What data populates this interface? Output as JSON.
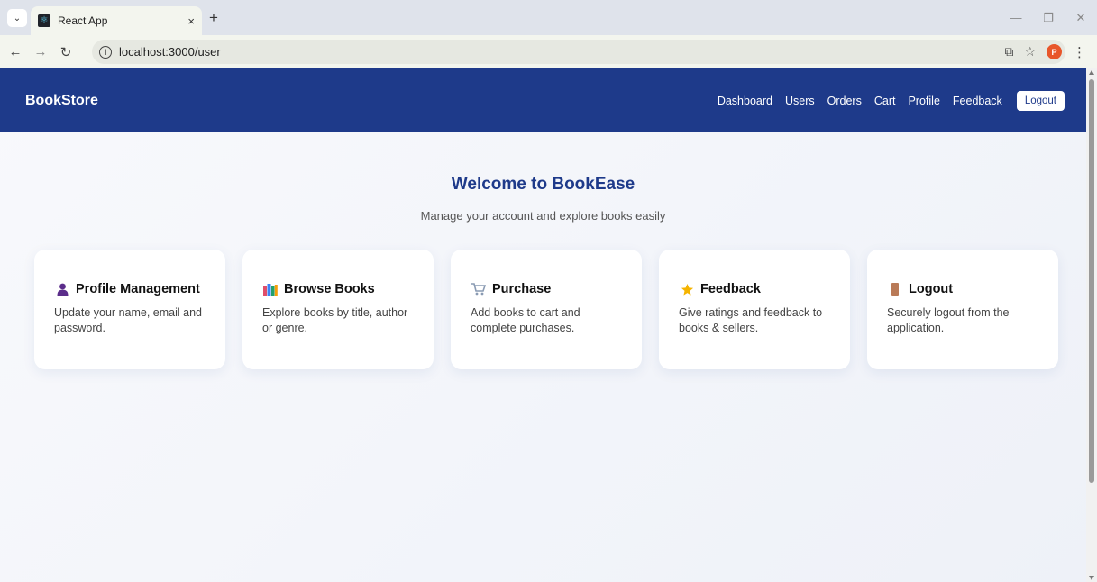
{
  "browser": {
    "tab_title": "React App",
    "tab_close": "×",
    "new_tab": "+",
    "url": "localhost:3000/user",
    "profile_initial": "P"
  },
  "navbar": {
    "brand": "BookStore",
    "links": [
      "Dashboard",
      "Users",
      "Orders",
      "Cart",
      "Profile",
      "Feedback"
    ],
    "logout_label": "Logout"
  },
  "hero": {
    "title": "Welcome to BookEase",
    "subtitle": "Manage your account and explore books easily"
  },
  "cards": [
    {
      "icon": "person-icon",
      "title": "Profile Management",
      "desc": "Update your name, email and password."
    },
    {
      "icon": "books-icon",
      "title": "Browse Books",
      "desc": "Explore books by title, author or genre."
    },
    {
      "icon": "cart-icon",
      "title": "Purchase",
      "desc": "Add books to cart and complete purchases."
    },
    {
      "icon": "star-icon",
      "title": "Feedback",
      "desc": "Give ratings and feedback to books & sellers."
    },
    {
      "icon": "door-icon",
      "title": "Logout",
      "desc": "Securely logout from the application."
    }
  ],
  "colors": {
    "navbar": "#1e3a8a",
    "heading": "#1e3a8a",
    "background": "#f4f6fb"
  }
}
